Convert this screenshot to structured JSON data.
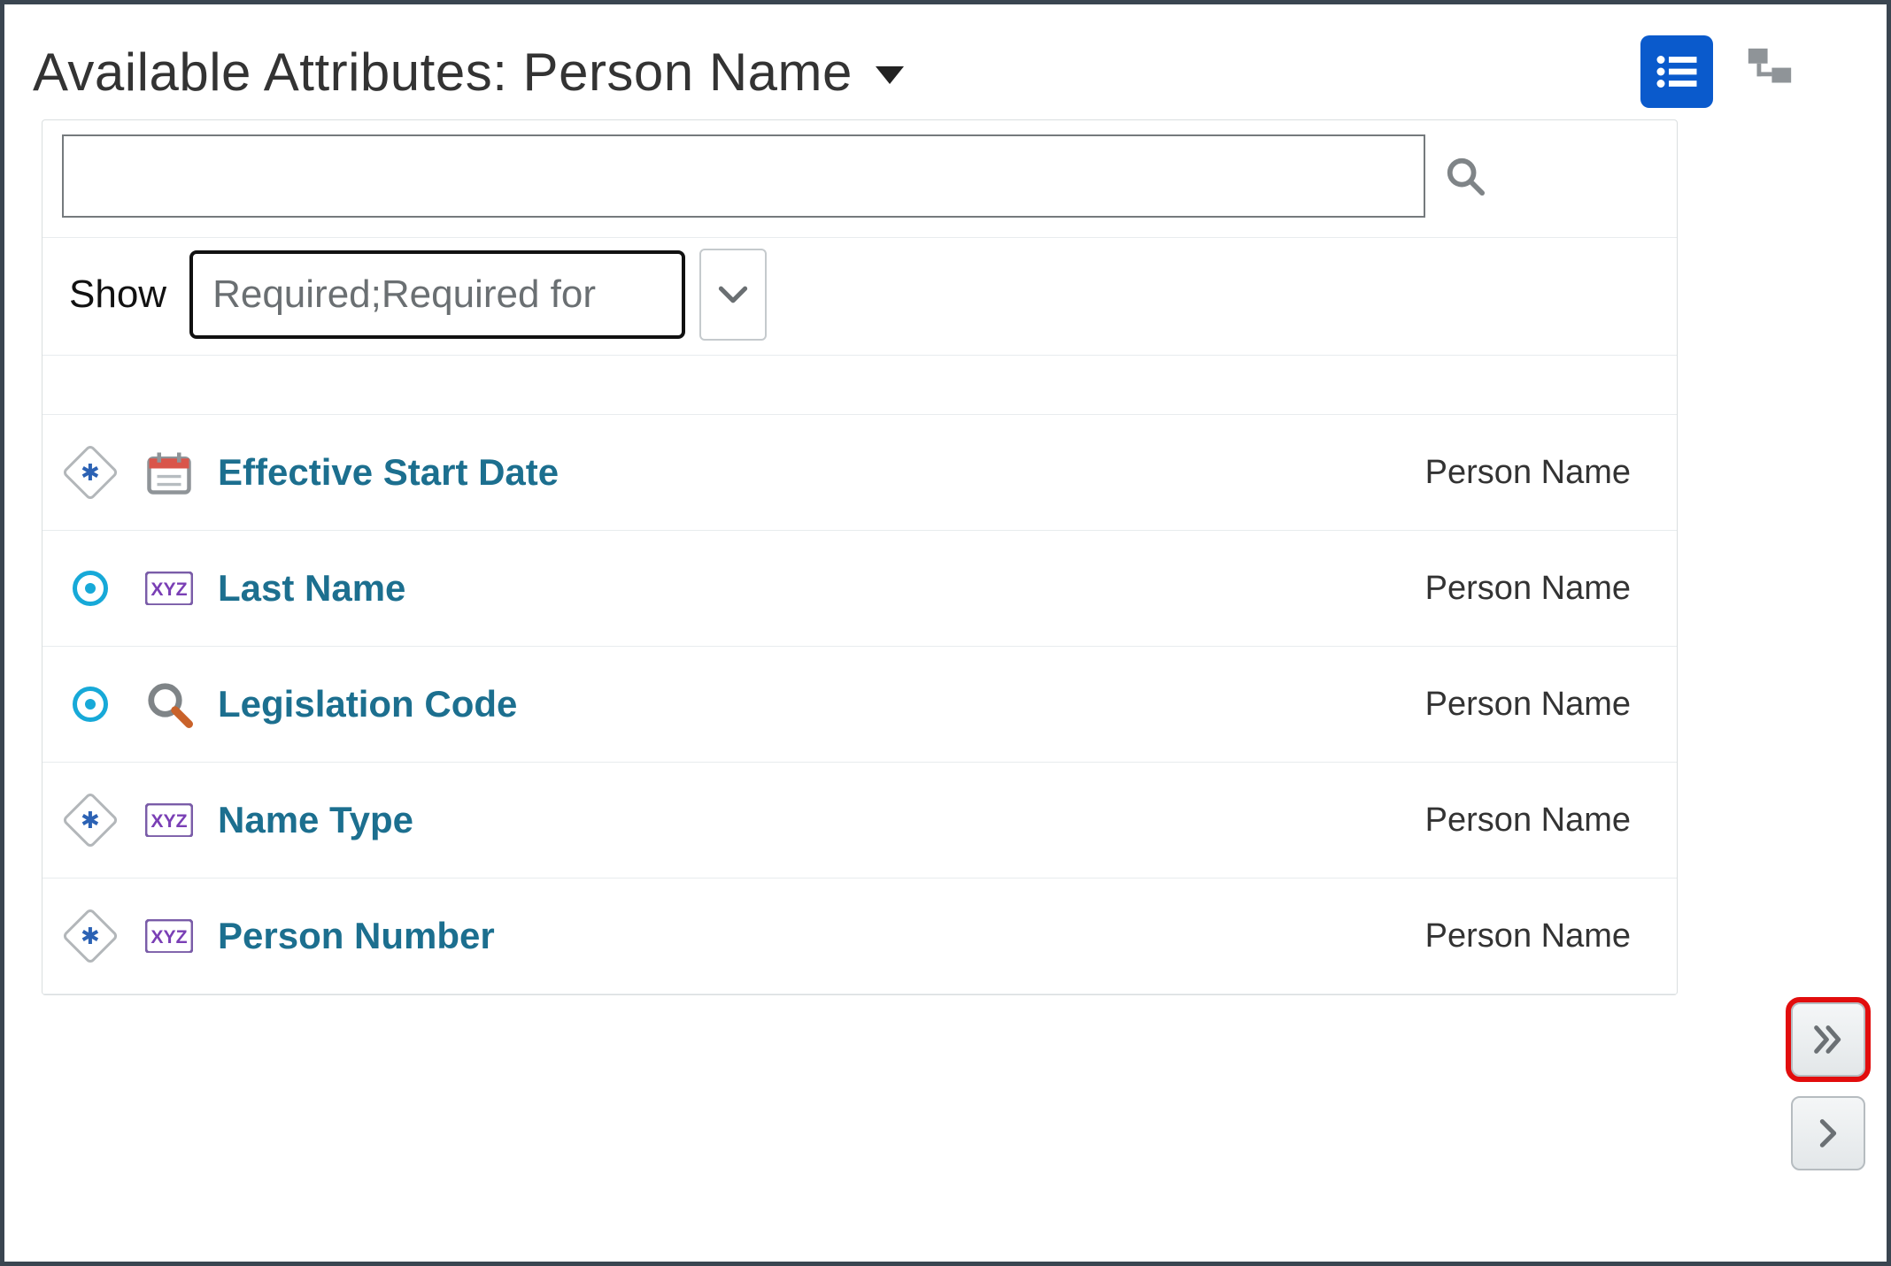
{
  "header": {
    "title": "Available Attributes: Person Name"
  },
  "search": {
    "value": "",
    "placeholder": ""
  },
  "filter": {
    "label": "Show",
    "value": "Required;Required for"
  },
  "attributes": [
    {
      "status": "diamond",
      "typeIcon": "calendar",
      "name": "Effective Start Date",
      "group": "Person Name"
    },
    {
      "status": "radio",
      "typeIcon": "xyz",
      "name": "Last Name",
      "group": "Person Name"
    },
    {
      "status": "radio",
      "typeIcon": "lookup",
      "name": "Legislation Code",
      "group": "Person Name"
    },
    {
      "status": "diamond",
      "typeIcon": "xyz",
      "name": "Name Type",
      "group": "Person Name"
    },
    {
      "status": "diamond",
      "typeIcon": "xyz",
      "name": "Person Number",
      "group": "Person Name"
    }
  ]
}
